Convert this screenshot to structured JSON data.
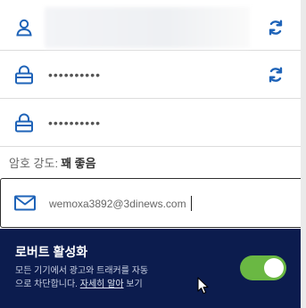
{
  "fields": {
    "username": {
      "icon": "user-icon",
      "value": ""
    },
    "password_1": {
      "icon": "lock-icon",
      "value": "••••••••••"
    },
    "password_2": {
      "icon": "lock-icon",
      "value": "••••••••••"
    }
  },
  "refresh_icon": "refresh-icon",
  "strength": {
    "label": "암호 강도:",
    "level": "꽤 좋음"
  },
  "email": {
    "icon": "mail-icon",
    "value": "wemoxa3892@3dinews.com"
  },
  "robot": {
    "title": "로버트 활성화",
    "description_line1": "모든 기기에서 광고와 트래커를 자동",
    "description_line2_prefix": "으로 차단합니다. ",
    "description_link": "자세히 알아",
    "description_suffix": " 보기",
    "toggle_on": true
  },
  "colors": {
    "icon_blue": "#1e63b8",
    "panel_navy": "#0c1c4e",
    "toggle_green": "#6ab843"
  }
}
